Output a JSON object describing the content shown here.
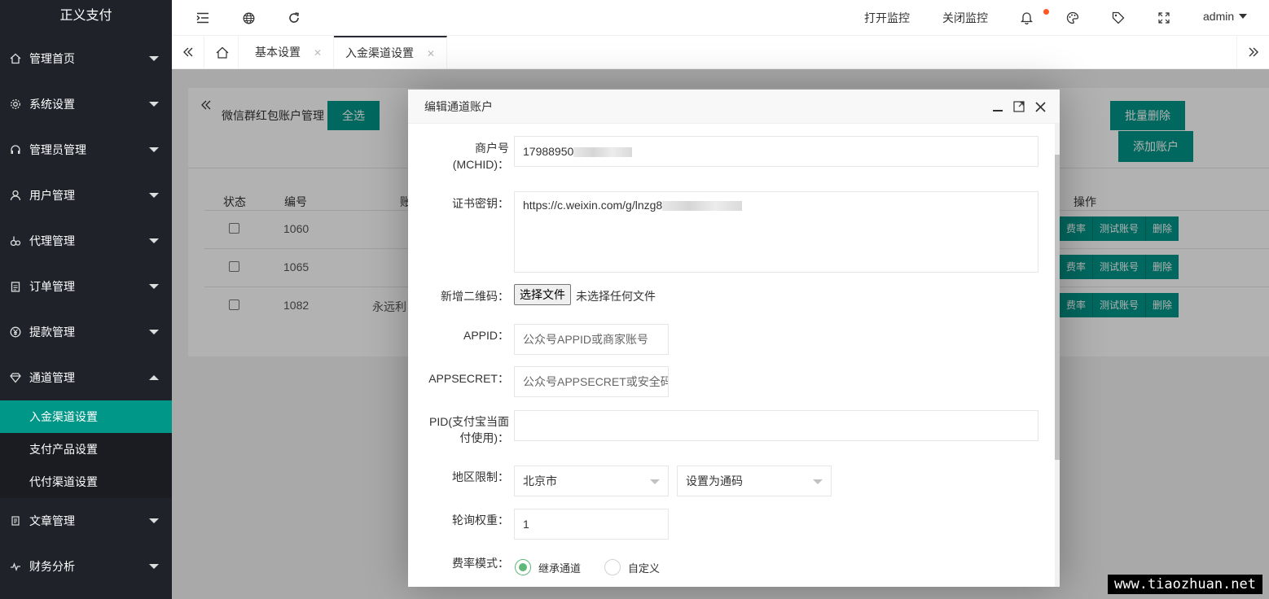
{
  "sidebar": {
    "logo": "正义支付",
    "items": [
      {
        "label": "管理首页"
      },
      {
        "label": "系统设置"
      },
      {
        "label": "管理员管理"
      },
      {
        "label": "用户管理"
      },
      {
        "label": "代理管理"
      },
      {
        "label": "订单管理"
      },
      {
        "label": "提款管理"
      },
      {
        "label": "通道管理"
      },
      {
        "label": "文章管理"
      },
      {
        "label": "财务分析"
      }
    ],
    "submenu": [
      {
        "label": "入金渠道设置",
        "active": true
      },
      {
        "label": "支付产品设置"
      },
      {
        "label": "代付渠道设置"
      }
    ]
  },
  "header": {
    "open_monitor": "打开监控",
    "close_monitor": "关闭监控",
    "user": "admin"
  },
  "tabs": [
    {
      "label": "基本设置"
    },
    {
      "label": "入金渠道设置",
      "active": true
    }
  ],
  "content": {
    "title": "微信群红包账户管理",
    "select_all": "全选",
    "batch_delete": "批量删除",
    "add_account": "添加账户",
    "columns": {
      "status": "状态",
      "id": "编号",
      "account": "账",
      "ops": "操作"
    },
    "rows": [
      {
        "id": "1060",
        "account": ""
      },
      {
        "id": "1065",
        "account": ""
      },
      {
        "id": "1082",
        "account": "永远利"
      }
    ],
    "ops": {
      "rate": "费率",
      "test": "测试账号",
      "delete": "删除"
    }
  },
  "modal": {
    "title": "编辑通道账户",
    "mchid_label_1": "商户号",
    "mchid_label_2": "(MCHID)：",
    "mchid_value": "17988950",
    "cert_label": "证书密钥：",
    "cert_value": "https://c.weixin.com/g/lnzg8",
    "qrcode_label": "新增二维码：",
    "file_button": "选择文件",
    "file_status": "未选择任何文件",
    "appid_label": "APPID：",
    "appid_placeholder": "公众号APPID或商家账号",
    "appsecret_label": "APPSECRET：",
    "appsecret_placeholder": "公众号APPSECRET或安全码",
    "pid_label_1": "PID(支付宝当面",
    "pid_label_2": "付使用)：",
    "pid_value": "",
    "region_label": "地区限制：",
    "region_value": "北京市",
    "region_mode": "设置为通码",
    "weight_label": "轮询权重：",
    "weight_value": "1",
    "rate_mode_label": "费率模式：",
    "rate_mode_options": [
      "继承通道",
      "自定义"
    ],
    "rate_mode_selected": "继承通道"
  },
  "watermark": "www.tiaozhuan.net"
}
